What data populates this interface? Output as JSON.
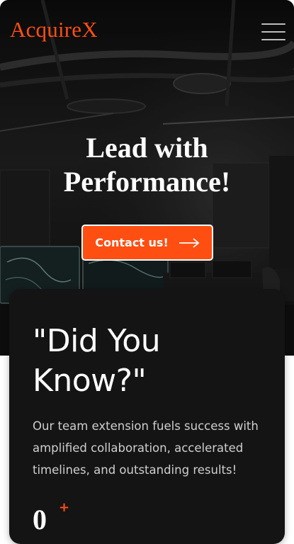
{
  "brand": {
    "name": "AcquireX"
  },
  "hero": {
    "headline": "Lead with\nPerformance!",
    "cta_label": "Contact us!",
    "cta_icon": "arrow-right-icon"
  },
  "menu": {
    "icon": "hamburger-menu-icon"
  },
  "info_card": {
    "title": "\"Did You Know?\"",
    "body": "Our team extension fuels success with amplified collaboration, accelerated timelines, and outstanding results!",
    "stat_value": "0",
    "stat_suffix": "+"
  },
  "colors": {
    "accent": "#ff4e12",
    "card_bg": "#141414",
    "text_light": "#ffffff"
  }
}
